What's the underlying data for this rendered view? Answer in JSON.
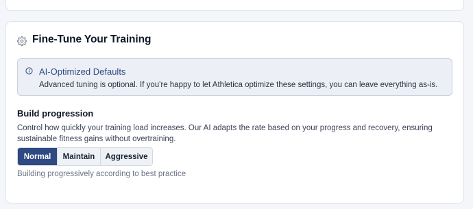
{
  "card": {
    "title": "Fine-Tune Your Training",
    "icon": "gear-icon"
  },
  "info": {
    "icon": "info-icon",
    "title": "AI-Optimized Defaults",
    "text": "Advanced tuning is optional. If you're happy to let Athletica optimize these settings, you can leave everything as-is."
  },
  "build_progression": {
    "title": "Build progression",
    "description": "Control how quickly your training load increases. Our AI adapts the rate based on your progress and recovery, ensuring sustainable fitness gains without overtraining.",
    "options": [
      {
        "label": "Normal",
        "selected": true
      },
      {
        "label": "Maintain",
        "selected": false
      },
      {
        "label": "Aggressive",
        "selected": false
      }
    ],
    "helper": "Building progressively according to best practice"
  },
  "colors": {
    "accent": "#2f4a83",
    "info_bg": "#eceff5"
  }
}
